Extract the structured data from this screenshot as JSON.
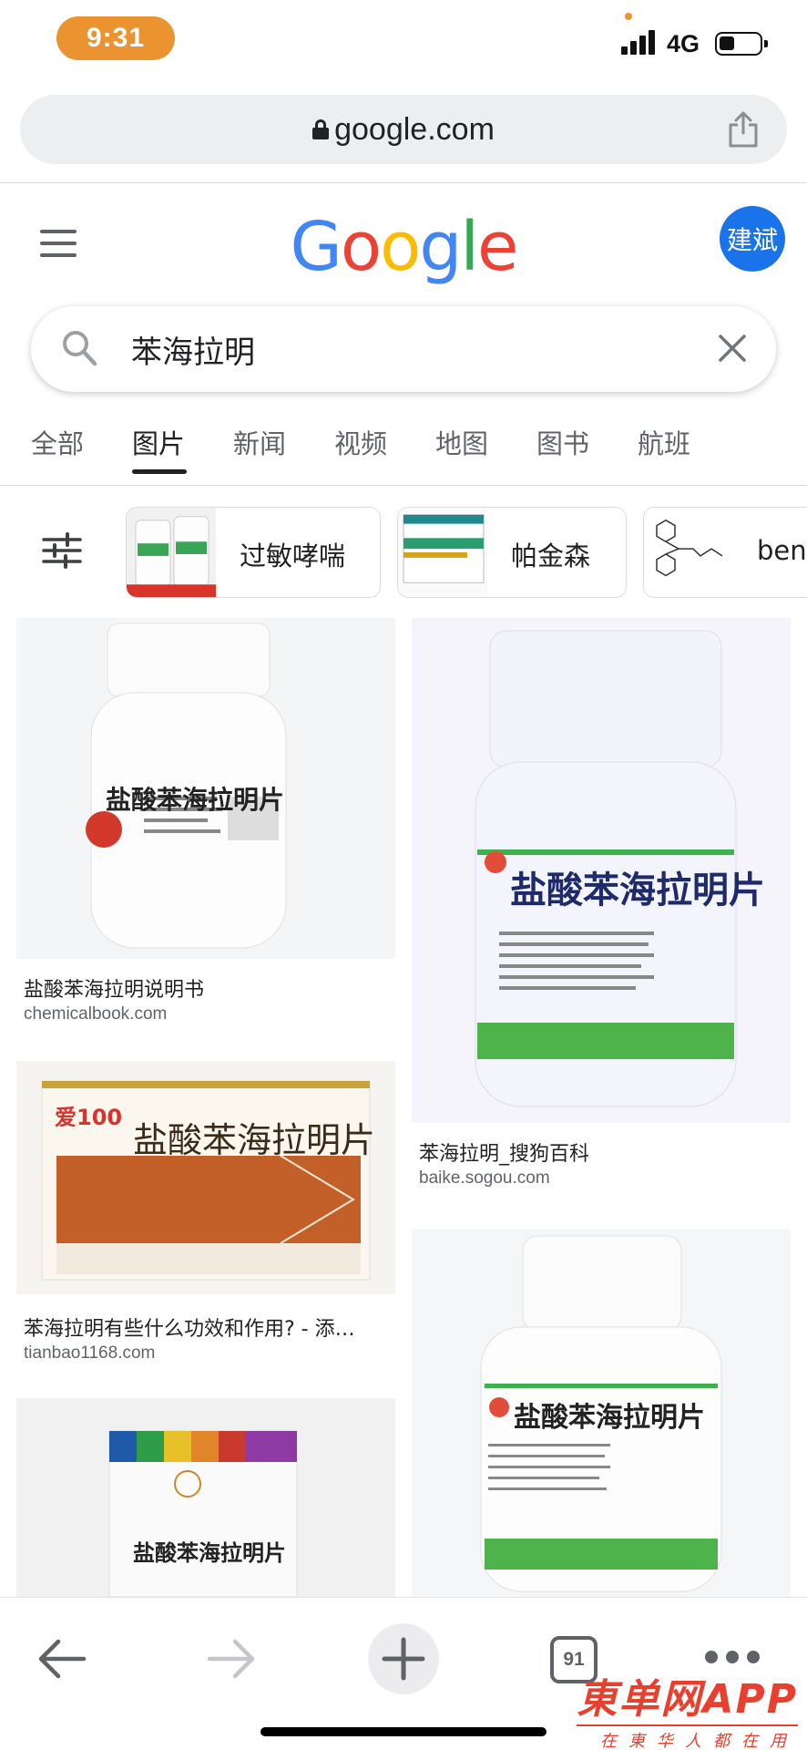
{
  "status_bar": {
    "time": "9:31",
    "network": "4G",
    "accent": "#eb9330"
  },
  "browser": {
    "url": "google.com"
  },
  "header": {
    "logo_letters": [
      "G",
      "o",
      "o",
      "g",
      "l",
      "e"
    ],
    "avatar_text": "建斌"
  },
  "search": {
    "query": "苯海拉明"
  },
  "tabs": [
    {
      "label": "全部",
      "active": false
    },
    {
      "label": "图片",
      "active": true
    },
    {
      "label": "新闻",
      "active": false
    },
    {
      "label": "视频",
      "active": false
    },
    {
      "label": "地图",
      "active": false
    },
    {
      "label": "图书",
      "active": false
    },
    {
      "label": "航班",
      "active": false
    }
  ],
  "chips": [
    {
      "label": "过敏哮喘"
    },
    {
      "label": "帕金森"
    },
    {
      "label": "ben"
    }
  ],
  "results": [
    {
      "title": "盐酸苯海拉明说明书",
      "source": "chemicalbook.com",
      "label_text": "盐酸苯海拉明片"
    },
    {
      "title": "苯海拉明_搜狗百科",
      "source": "baike.sogou.com",
      "label_text": "盐酸苯海拉明片"
    },
    {
      "title": "苯海拉明有些什么功效和作用? - 添…",
      "source": "tianbao1168.com",
      "label_text": "盐酸苯海拉明片",
      "brand": "爱100"
    },
    {
      "title": "",
      "source": "",
      "label_text": "盐酸苯海拉明片"
    },
    {
      "title": "",
      "source": "",
      "label_text": "盐酸苯海拉明片"
    }
  ],
  "bottom_nav": {
    "tab_count": "91"
  },
  "watermark": {
    "main": "東单网APP",
    "sub": "在東华人都在用"
  }
}
